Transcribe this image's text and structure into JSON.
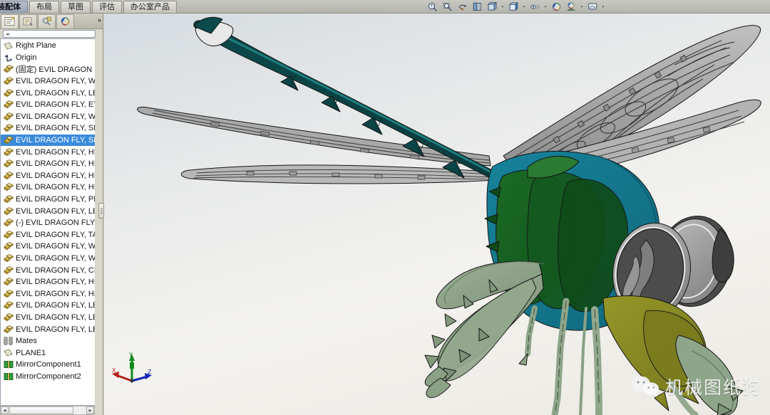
{
  "app": {
    "title": "SolidWorks Assembly",
    "command_tabs": [
      {
        "label": "装配体",
        "active": true,
        "clipped": true
      },
      {
        "label": "布局",
        "active": false
      },
      {
        "label": "草图",
        "active": false
      },
      {
        "label": "评估",
        "active": false
      },
      {
        "label": "办公室产品",
        "active": false
      }
    ],
    "view_toolbar": [
      {
        "name": "zoom-to-fit-icon",
        "caret": false
      },
      {
        "name": "zoom-to-area-icon",
        "caret": false
      },
      {
        "name": "rotate-view-icon",
        "caret": false
      },
      {
        "name": "section-view-icon",
        "caret": false
      },
      {
        "name": "view-orientation-icon",
        "caret": true
      },
      {
        "name": "display-style-icon",
        "caret": true
      },
      {
        "name": "hide-show-items-icon",
        "caret": true
      },
      {
        "name": "appearances-icon",
        "caret": false
      },
      {
        "name": "scene-icon",
        "caret": true
      },
      {
        "name": "view-settings-icon",
        "caret": true
      }
    ]
  },
  "left_panel": {
    "panel_tabs": [
      {
        "name": "feature-manager-tab",
        "selected": true,
        "glyph": "tree"
      },
      {
        "name": "property-manager-tab",
        "selected": false,
        "glyph": "props"
      },
      {
        "name": "configuration-manager-tab",
        "selected": false,
        "glyph": "config"
      },
      {
        "name": "display-manager-tab",
        "selected": false,
        "glyph": "display"
      }
    ],
    "overflow_label": "»",
    "filter_placeholder": "",
    "tree": [
      {
        "label": "Right Plane",
        "icon": "plane-icon",
        "selected": false
      },
      {
        "label": "Origin",
        "icon": "origin-icon",
        "selected": false
      },
      {
        "label": "(固定) EVIL DRAGON F",
        "icon": "component-icon",
        "selected": false
      },
      {
        "label": "EVIL DRAGON FLY, WI",
        "icon": "component-icon",
        "selected": false
      },
      {
        "label": "EVIL DRAGON FLY, LEG",
        "icon": "component-icon",
        "selected": false
      },
      {
        "label": "EVIL DRAGON FLY, EYE",
        "icon": "component-icon",
        "selected": false
      },
      {
        "label": "EVIL DRAGON FLY, WI",
        "icon": "component-icon",
        "selected": false
      },
      {
        "label": "EVIL DRAGON FLY, SPI",
        "icon": "component-icon",
        "selected": false
      },
      {
        "label": "EVIL DRAGON FLY, SPI",
        "icon": "component-icon",
        "selected": true
      },
      {
        "label": "EVIL DRAGON FLY, HE",
        "icon": "component-icon",
        "selected": false
      },
      {
        "label": "EVIL DRAGON FLY, HE",
        "icon": "component-icon",
        "selected": false
      },
      {
        "label": "EVIL DRAGON FLY, HE",
        "icon": "component-icon",
        "selected": false
      },
      {
        "label": "EVIL DRAGON FLY, HE",
        "icon": "component-icon",
        "selected": false
      },
      {
        "label": "EVIL DRAGON FLY, PEI",
        "icon": "component-icon",
        "selected": false
      },
      {
        "label": "EVIL DRAGON FLY, LEG",
        "icon": "component-icon",
        "selected": false
      },
      {
        "label": "(-) EVIL DRAGON FLY,",
        "icon": "component-icon",
        "selected": false
      },
      {
        "label": "EVIL DRAGON FLY, TAI",
        "icon": "component-icon",
        "selected": false
      },
      {
        "label": "EVIL DRAGON FLY, WI",
        "icon": "component-icon",
        "selected": false
      },
      {
        "label": "EVIL DRAGON FLY, WI",
        "icon": "component-icon",
        "selected": false
      },
      {
        "label": "EVIL DRAGON FLY, CH",
        "icon": "component-icon",
        "selected": false
      },
      {
        "label": "EVIL DRAGON FLY, HE",
        "icon": "component-icon",
        "selected": false
      },
      {
        "label": "EVIL DRAGON FLY, HE",
        "icon": "component-icon",
        "selected": false
      },
      {
        "label": "EVIL DRAGON FLY, LEG",
        "icon": "component-icon",
        "selected": false
      },
      {
        "label": "EVIL DRAGON FLY, LEG",
        "icon": "component-icon",
        "selected": false
      },
      {
        "label": "EVIL DRAGON FLY, LEG",
        "icon": "component-icon",
        "selected": false
      },
      {
        "label": "Mates",
        "icon": "mates-icon",
        "selected": false
      },
      {
        "label": "PLANE1",
        "icon": "plane-icon",
        "selected": false
      },
      {
        "label": "MirrorComponent1",
        "icon": "mirror-icon",
        "selected": false
      },
      {
        "label": "MirrorComponent2",
        "icon": "mirror-icon",
        "selected": false
      }
    ]
  },
  "viewport": {
    "triad": {
      "x_label": "X",
      "y_label": "Y",
      "z_label": "Z",
      "x_color": "#b5211a",
      "y_color": "#0f8a1d",
      "z_color": "#1426b4"
    },
    "model_colors": {
      "abdomen_teal": "#0d4c4c",
      "thorax_teal": "#14788a",
      "dark_green": "#165e22",
      "olive": "#86892a",
      "sage": "#8ea58a",
      "eye_gray": "#9a9a9a",
      "eye_dark": "#3b3b3b",
      "wing_gray": "#a8a8a8",
      "outline": "#1a1a1a"
    }
  },
  "watermark": {
    "text": "机械图纸狗",
    "icon": "wechat-icon"
  }
}
